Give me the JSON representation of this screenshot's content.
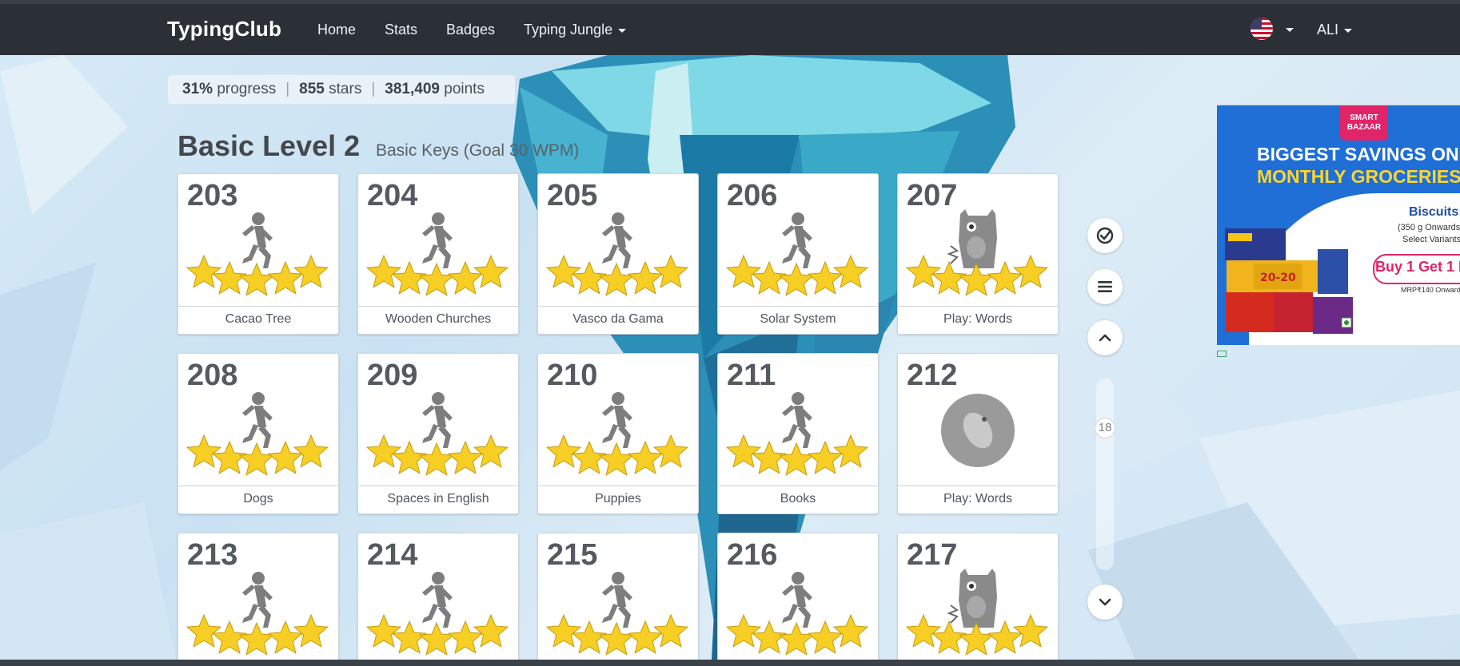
{
  "nav": {
    "brand": "TypingClub",
    "links": [
      "Home",
      "Stats",
      "Badges",
      "Typing Jungle"
    ],
    "user": "ALI"
  },
  "stats": {
    "progress_value": "31%",
    "progress_label": "progress",
    "stars_value": "855",
    "stars_label": "stars",
    "points_value": "381,409",
    "points_label": "points"
  },
  "level": {
    "title": "Basic Level 2",
    "subtitle": "Basic Keys (Goal 30 WPM)"
  },
  "lessons": [
    {
      "num": "203",
      "label": "Cacao Tree",
      "icon": "runner-icon",
      "stars": 5
    },
    {
      "num": "204",
      "label": "Wooden Churches",
      "icon": "runner-icon",
      "stars": 5
    },
    {
      "num": "205",
      "label": "Vasco da Gama",
      "icon": "runner-icon",
      "stars": 5
    },
    {
      "num": "206",
      "label": "Solar System",
      "icon": "runner-icon",
      "stars": 5
    },
    {
      "num": "207",
      "label": "Play: Words",
      "icon": "monster-icon",
      "stars": 5
    },
    {
      "num": "208",
      "label": "Dogs",
      "icon": "runner-icon",
      "stars": 5
    },
    {
      "num": "209",
      "label": "Spaces in English",
      "icon": "runner-icon",
      "stars": 5
    },
    {
      "num": "210",
      "label": "Puppies",
      "icon": "runner-icon",
      "stars": 5
    },
    {
      "num": "211",
      "label": "Books",
      "icon": "runner-icon",
      "stars": 5
    },
    {
      "num": "212",
      "label": "Play: Words",
      "icon": "game-badge-icon",
      "stars": 0
    },
    {
      "num": "213",
      "label": "",
      "icon": "runner-icon",
      "stars": 5
    },
    {
      "num": "214",
      "label": "",
      "icon": "runner-icon",
      "stars": 5
    },
    {
      "num": "215",
      "label": "",
      "icon": "runner-icon",
      "stars": 5
    },
    {
      "num": "216",
      "label": "",
      "icon": "runner-icon",
      "stars": 5
    },
    {
      "num": "217",
      "label": "",
      "icon": "monster-icon",
      "stars": 5
    }
  ],
  "scroll": {
    "indicator": "18"
  },
  "ad": {
    "logo": "SMART BAZAAR",
    "headline1": "BIGGEST SAVINGS ON",
    "headline2": "MONTHLY GROCERIES",
    "product": "Biscuits",
    "product_note1": "(350 g Onwards)",
    "product_note2": "Select Variants",
    "offer": "Buy 1 Get 1 F",
    "mrp": "MRP₹140 Onwards"
  },
  "colors": {
    "navbar": "#2b3036",
    "star": "#f7cf24",
    "ad_blue": "#1f6fd6",
    "ad_yellow": "#ffd52e",
    "offer_pink": "#e0246a"
  }
}
